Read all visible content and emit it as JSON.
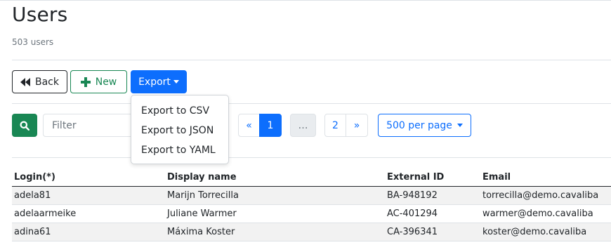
{
  "header": {
    "title": "Users",
    "subtitle": "503 users"
  },
  "toolbar": {
    "back_label": "Back",
    "new_label": "New",
    "export_label": "Export"
  },
  "export_menu": {
    "items": [
      "Export to CSV",
      "Export to JSON",
      "Export to YAML"
    ]
  },
  "filter": {
    "placeholder": "Filter",
    "value": ""
  },
  "pagination": {
    "prev": "«",
    "page1": "1",
    "gap": "…",
    "page2": "2",
    "next": "»",
    "current_page": 1
  },
  "per_page": {
    "label": "500 per page"
  },
  "colors": {
    "primary": "#0d6efd",
    "success": "#198754",
    "dark": "#212529"
  },
  "table": {
    "columns": [
      "Login(*)",
      "Display name",
      "External ID",
      "Email"
    ],
    "rows": [
      [
        "adela81",
        "Marijn Torrecilla",
        "BA-948192",
        "torrecilla@demo.cavaliba"
      ],
      [
        "adelaarmeike",
        "Juliane Warmer",
        "AC-401294",
        "warmer@demo.cavaliba"
      ],
      [
        "adina61",
        "Máxima Koster",
        "CA-396341",
        "koster@demo.cavaliba"
      ]
    ]
  }
}
